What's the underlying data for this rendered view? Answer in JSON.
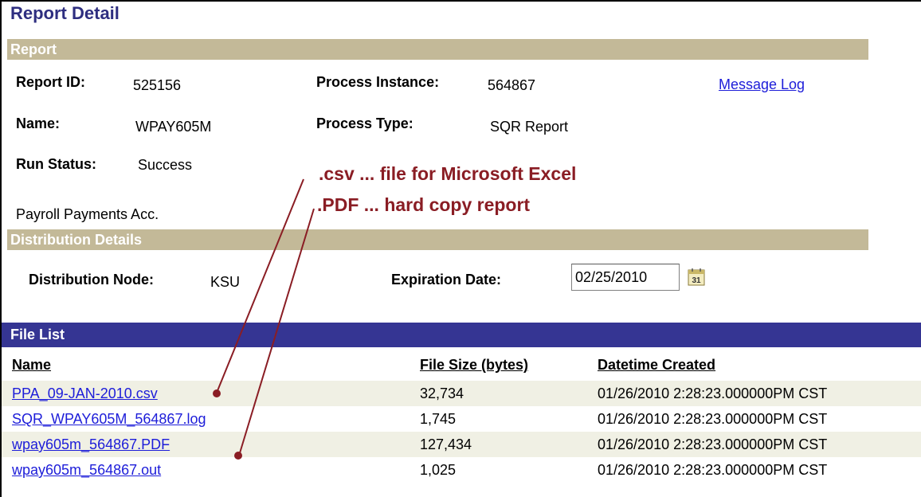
{
  "page": {
    "title": "Report Detail"
  },
  "report_section": {
    "heading": "Report",
    "report_id_label": "Report ID:",
    "report_id": "525156",
    "process_instance_label": "Process Instance:",
    "process_instance": "564867",
    "message_log_link": "Message Log",
    "name_label": "Name:",
    "name": "WPAY605M",
    "process_type_label": "Process Type:",
    "process_type": "SQR Report",
    "run_status_label": "Run Status:",
    "run_status": "Success",
    "description": "Payroll Payments Acc."
  },
  "distribution": {
    "heading": "Distribution Details",
    "node_label": "Distribution Node:",
    "node": "KSU",
    "expiration_label": "Expiration Date:",
    "expiration_date": "02/25/2010",
    "calendar_icon": "calendar-icon"
  },
  "annotations": {
    "csv_note": ".csv ... file for Microsoft Excel",
    "pdf_note": ".PDF ... hard copy report",
    "color": "#8a1d24"
  },
  "file_list": {
    "heading": "File List",
    "columns": [
      "Name",
      "File Size (bytes)",
      "Datetime Created"
    ],
    "rows": [
      {
        "name": "PPA_09-JAN-2010.csv",
        "size": "32,734",
        "created": "01/26/2010  2:28:23.000000PM CST"
      },
      {
        "name": "SQR_WPAY605M_564867.log",
        "size": "1,745",
        "created": "01/26/2010  2:28:23.000000PM CST"
      },
      {
        "name": "wpay605m_564867.PDF",
        "size": "127,434",
        "created": "01/26/2010  2:28:23.000000PM CST"
      },
      {
        "name": "wpay605m_564867.out",
        "size": "1,025",
        "created": "01/26/2010  2:28:23.000000PM CST"
      }
    ]
  },
  "colors": {
    "title": "#2e2e80",
    "section_band": "#c3b998",
    "file_list_bar": "#353593",
    "link": "#1d1dd9"
  }
}
